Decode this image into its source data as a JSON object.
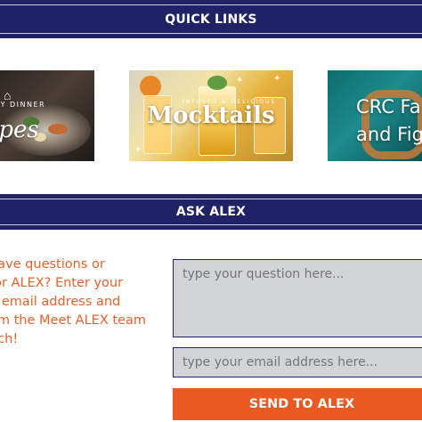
{
  "quick_links": {
    "title": "QUICK LINKS",
    "cards": [
      {
        "name": "recipes",
        "small_text": "SY DINNER",
        "script_text": "ipes"
      },
      {
        "name": "mocktails",
        "small_text": "INFUSED & DELICIOUS",
        "title": "Mocktails"
      },
      {
        "name": "crc",
        "line1": "CRC Fa",
        "line2": "and Fig"
      }
    ]
  },
  "ask": {
    "title": "ASK ALEX",
    "body_lines": [
      "have questions or",
      "for ALEX? Enter your",
      "d email address and",
      "om the Meet ALEX team",
      "uch!"
    ],
    "question_placeholder": "type your question here...",
    "email_placeholder": "type your email address here...",
    "send_label": "SEND TO ALEX"
  },
  "colors": {
    "bar_navy": "#1f2366",
    "accent_orange": "#e85a22",
    "field_gray": "#d2d4d7"
  }
}
